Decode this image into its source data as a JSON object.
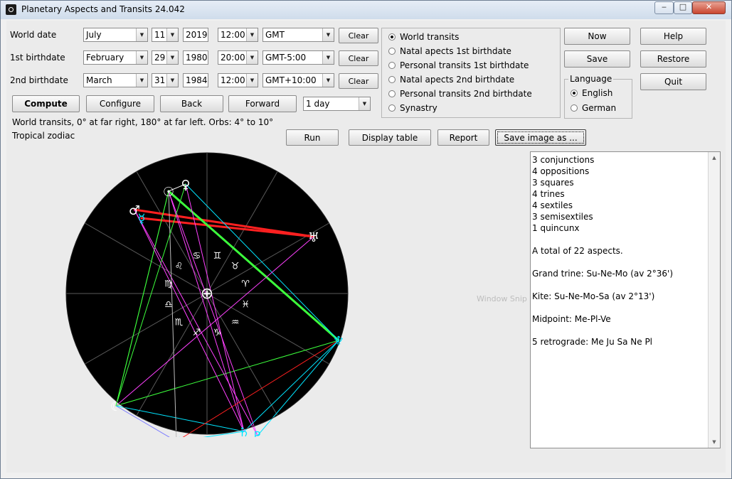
{
  "window": {
    "title": "Planetary Aspects and Transits 24.042",
    "controls": {
      "minimize": "‒",
      "maximize": "□",
      "close": "✕"
    }
  },
  "rows": [
    {
      "label": "World date",
      "month": "July",
      "day": "11",
      "year": "2019",
      "time": "12:00",
      "zone": "GMT",
      "clear": "Clear"
    },
    {
      "label": "1st birthdate",
      "month": "February",
      "day": "29",
      "year": "1980",
      "time": "20:00",
      "zone": "GMT-5:00",
      "clear": "Clear"
    },
    {
      "label": "2nd birthdate",
      "month": "March",
      "day": "31",
      "year": "1984",
      "time": "12:00",
      "zone": "GMT+10:00",
      "clear": "Clear"
    }
  ],
  "actions": {
    "compute": "Compute",
    "configure": "Configure",
    "back": "Back",
    "forward": "Forward",
    "step": "1 day"
  },
  "status": {
    "line1": "World transits, 0° at far right, 180° at far left.  Orbs: 4° to 10°",
    "line2": "Tropical zodiac"
  },
  "modes": [
    {
      "label": "World transits",
      "selected": true
    },
    {
      "label": "Natal apects 1st birthdate",
      "selected": false
    },
    {
      "label": "Personal transits 1st birthdate",
      "selected": false
    },
    {
      "label": "Natal apects 2nd birthdate",
      "selected": false
    },
    {
      "label": "Personal transits 2nd birthdate",
      "selected": false
    },
    {
      "label": "Synastry",
      "selected": false
    }
  ],
  "side_buttons": {
    "now": "Now",
    "help": "Help",
    "save": "Save",
    "restore": "Restore",
    "quit": "Quit"
  },
  "language": {
    "legend": "Language",
    "english": "English",
    "german": "German",
    "selected": "English"
  },
  "toolbar": {
    "run": "Run",
    "display_table": "Display table",
    "report": "Report",
    "save_image": "Save image as ..."
  },
  "overlay": {
    "window_snip": "Window Snip"
  },
  "results": [
    "3 conjunctions",
    "4 oppositions",
    "3 squares",
    "4 trines",
    "4 sextiles",
    "3 semisextiles",
    "1 quincunx",
    "",
    "A total of 22 aspects.",
    "",
    "Grand trine: Su-Ne-Mo (av 2°36')",
    "",
    "Kite: Su-Ne-Mo-Sa (av 2°13')",
    "",
    "Midpoint: Me-Pl-Ve",
    "",
    "5 retrograde: Me Ju Sa Ne Pl"
  ],
  "wheel": {
    "center_symbol": "⊕",
    "zodiac": [
      {
        "glyph": "♈",
        "name": "aries"
      },
      {
        "glyph": "♉",
        "name": "taurus"
      },
      {
        "glyph": "♊",
        "name": "gemini"
      },
      {
        "glyph": "♋",
        "name": "cancer"
      },
      {
        "glyph": "♌",
        "name": "leo"
      },
      {
        "glyph": "♍",
        "name": "virgo"
      },
      {
        "glyph": "♎",
        "name": "libra"
      },
      {
        "glyph": "♏",
        "name": "scorpio"
      },
      {
        "glyph": "♐",
        "name": "sagittarius"
      },
      {
        "glyph": "♑",
        "name": "capricorn"
      },
      {
        "glyph": "♒",
        "name": "aquarius"
      },
      {
        "glyph": "♓",
        "name": "pisces"
      }
    ],
    "planets": [
      {
        "id": "sun",
        "glyph": "☉",
        "color": "#ffffff"
      },
      {
        "id": "venus",
        "glyph": "♀",
        "color": "#ffffff"
      },
      {
        "id": "mars",
        "glyph": "♂",
        "color": "#ffffff"
      },
      {
        "id": "mercury",
        "glyph": "☿",
        "color": "#00e5ff"
      },
      {
        "id": "uranus",
        "glyph": "♅",
        "color": "#ffffff"
      },
      {
        "id": "neptune",
        "glyph": "♆",
        "color": "#00e5ff"
      },
      {
        "id": "moon",
        "glyph": "☾",
        "color": "#ffffff"
      },
      {
        "id": "jupiter",
        "glyph": "♃",
        "color": "#00e5ff"
      },
      {
        "id": "saturn",
        "glyph": "♄",
        "color": "#00e5ff"
      },
      {
        "id": "pluto",
        "glyph": "♇",
        "color": "#00e5ff"
      }
    ],
    "aspects": [
      {
        "from": "mars",
        "to": "uranus",
        "color": "#ff2020"
      },
      {
        "from": "mercury",
        "to": "uranus",
        "color": "#ff2020"
      },
      {
        "from": "sun",
        "to": "neptune",
        "color": "#3cff3c"
      },
      {
        "from": "sun",
        "to": "moon",
        "color": "#3cff3c"
      },
      {
        "from": "moon",
        "to": "neptune",
        "color": "#3cff3c"
      },
      {
        "from": "venus",
        "to": "neptune",
        "color": "#00e5ff"
      },
      {
        "from": "sun",
        "to": "saturn",
        "color": "#ff40ff"
      },
      {
        "from": "sun",
        "to": "pluto",
        "color": "#ff40ff"
      },
      {
        "from": "venus",
        "to": "saturn",
        "color": "#ff40ff"
      },
      {
        "from": "mars",
        "to": "pluto",
        "color": "#ff40ff"
      },
      {
        "from": "moon",
        "to": "uranus",
        "color": "#ff40ff"
      },
      {
        "from": "moon",
        "to": "jupiter",
        "color": "#7b7bff"
      },
      {
        "from": "moon",
        "to": "saturn",
        "color": "#00e5ff"
      },
      {
        "from": "jupiter",
        "to": "neptune",
        "color": "#ff2020"
      },
      {
        "from": "jupiter",
        "to": "saturn",
        "color": "#00e5ff"
      },
      {
        "from": "saturn",
        "to": "neptune",
        "color": "#00e5ff"
      },
      {
        "from": "pluto",
        "to": "neptune",
        "color": "#00e5ff"
      },
      {
        "from": "venus",
        "to": "sun",
        "color": "#ffffff"
      },
      {
        "from": "sun",
        "to": "jupiter",
        "color": "#bbbbbb"
      },
      {
        "from": "moon",
        "to": "sun",
        "color": "#3cff3c"
      },
      {
        "from": "venus",
        "to": "moon",
        "color": "#3cff3c"
      },
      {
        "from": "mars",
        "to": "saturn",
        "color": "#ff40ff"
      }
    ]
  }
}
